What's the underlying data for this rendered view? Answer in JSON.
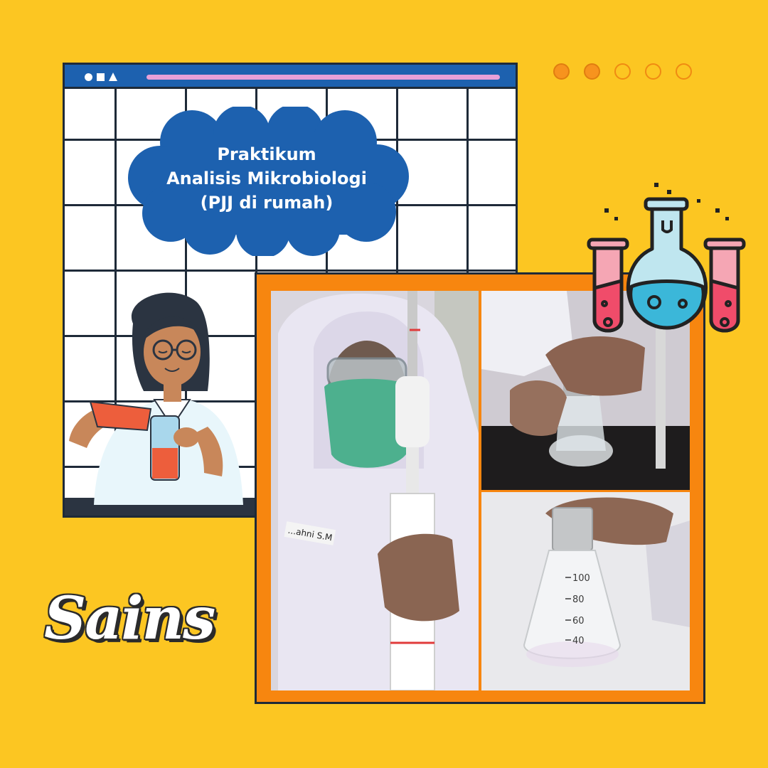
{
  "title": {
    "lines": [
      "Praktikum",
      "Analisis Mikrobiologi",
      "(PJJ di rumah)"
    ]
  },
  "label": "Sains",
  "icons": {
    "scientist": "scientist-illustration",
    "flask": "flask-test-tubes-icon"
  },
  "photos": {
    "left_name_tag": "...ahni S.M",
    "flask_marks": [
      "100",
      "80",
      "60",
      "40"
    ]
  },
  "colors": {
    "background": "#fcc622",
    "window_bar": "#1d61af",
    "cloud": "#1d61af",
    "collage_border": "#f7860f",
    "accent_pink": "#e7a0d8",
    "dots": "#f7931e"
  },
  "dots": {
    "total": 5,
    "filled": 2
  }
}
